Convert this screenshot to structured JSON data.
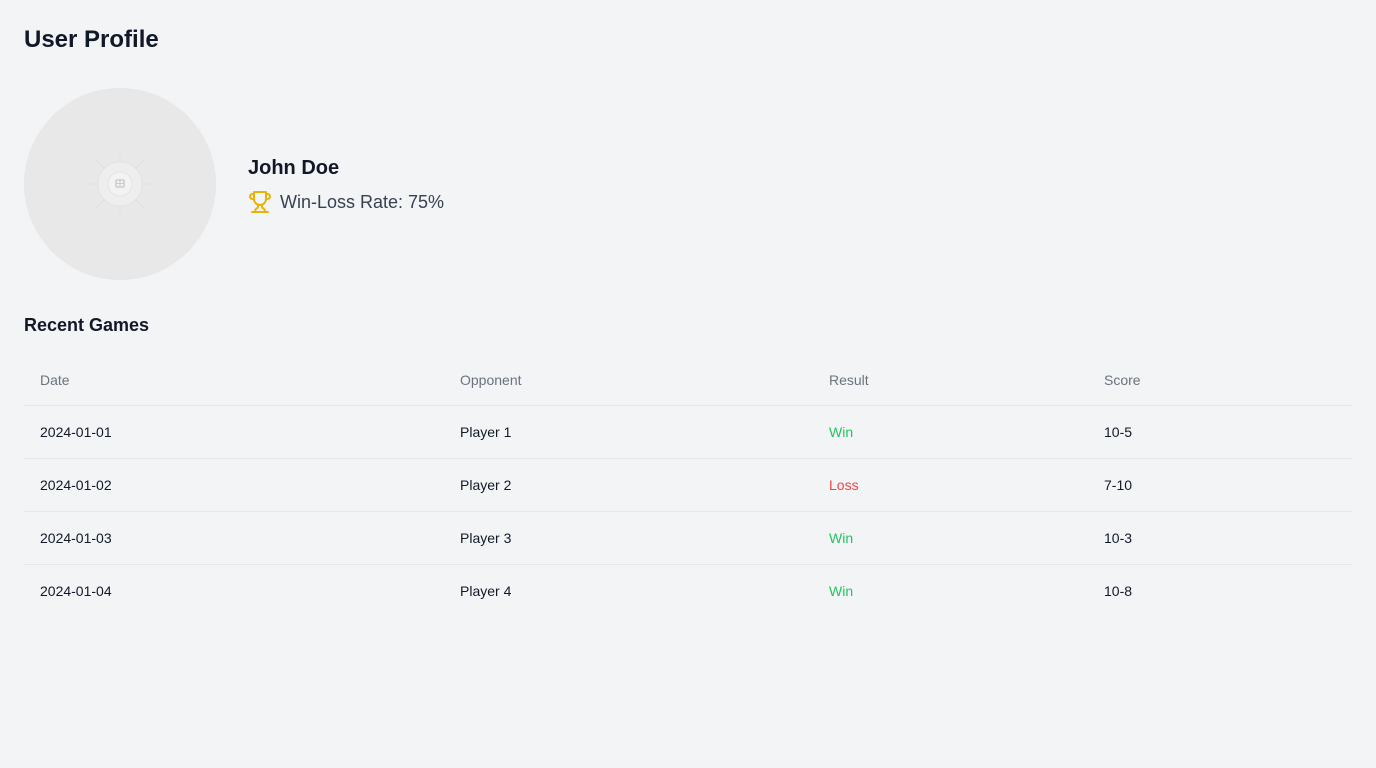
{
  "page": {
    "title": "User Profile"
  },
  "profile": {
    "name": "John Doe",
    "win_loss_rate": "Win-Loss Rate: 75%",
    "trophy_icon": "trophy-icon",
    "avatar_icon": "broken-image-icon"
  },
  "recent_games": {
    "title": "Recent Games",
    "columns": [
      "Date",
      "Opponent",
      "Result",
      "Score"
    ],
    "rows": [
      {
        "date": "2024-01-01",
        "opponent": "Player 1",
        "result": "Win",
        "score": "10-5"
      },
      {
        "date": "2024-01-02",
        "opponent": "Player 2",
        "result": "Loss",
        "score": "7-10"
      },
      {
        "date": "2024-01-03",
        "opponent": "Player 3",
        "result": "Win",
        "score": "10-3"
      },
      {
        "date": "2024-01-04",
        "opponent": "Player 4",
        "result": "Win",
        "score": "10-8"
      }
    ]
  },
  "colors": {
    "background": "#f2f4f6",
    "win": "#22c55e",
    "loss": "#ef4444",
    "trophy": "#eab308"
  }
}
